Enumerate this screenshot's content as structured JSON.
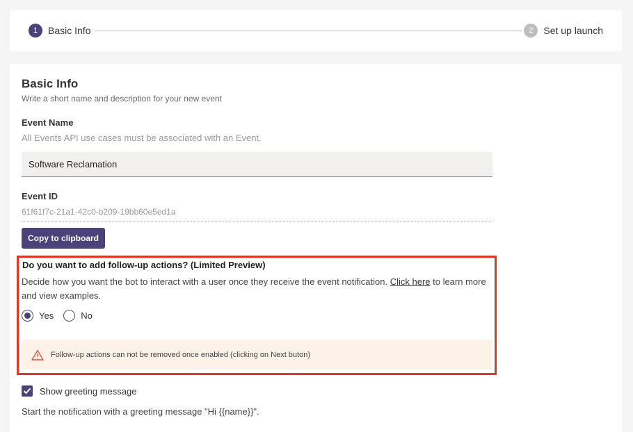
{
  "stepper": {
    "steps": [
      {
        "number": "1",
        "label": "Basic Info",
        "state": "active"
      },
      {
        "number": "2",
        "label": "Set up launch",
        "state": "inactive"
      }
    ]
  },
  "basic_info": {
    "title": "Basic Info",
    "subtitle": "Write a short name and description for your new event"
  },
  "event_name": {
    "label": "Event Name",
    "help": "All Events API use cases must be associated with an Event.",
    "value": "Software Reclamation"
  },
  "event_id": {
    "label": "Event ID",
    "value": "61f61f7c-21a1-42c0-b209-19bb60e5ed1a",
    "copy_label": "Copy to clipboard"
  },
  "follow_up": {
    "title": "Do you want to add follow-up actions? (Limited Preview)",
    "desc_before": "Decide how you want the bot to interact with a user once they receive the event notification. ",
    "link_text": "Click here",
    "desc_after": " to learn more and view examples.",
    "options": [
      {
        "label": "Yes",
        "checked": true
      },
      {
        "label": "No",
        "checked": false
      }
    ],
    "warning": "Follow-up actions can not be removed once enabled (clicking on Next buton)"
  },
  "greeting": {
    "checkbox_label": "Show greeting message",
    "checked": true,
    "description": "Start the notification with a greeting message \"Hi {{name}}\"."
  },
  "colors": {
    "accent": "#4a4279",
    "highlight": "#e8331e",
    "warning_bg": "#fdf2e8",
    "warning_icon": "#e8533e"
  }
}
